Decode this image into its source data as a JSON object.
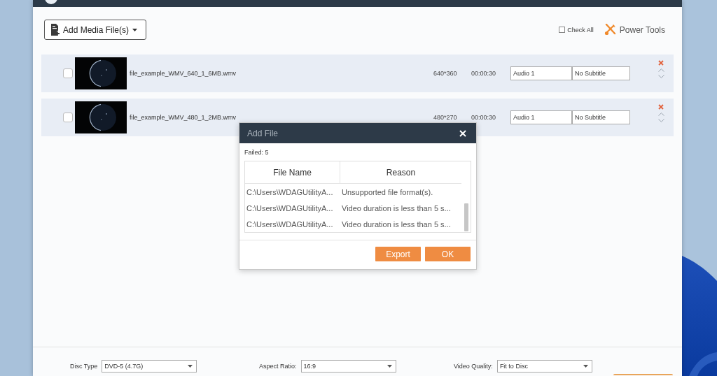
{
  "toolbar": {
    "add_media": "Add Media File(s)",
    "check_all": {
      "label": "Check All",
      "checked": false
    },
    "power_tools": "Power Tools"
  },
  "files": [
    {
      "checked": false,
      "name": "file_example_WMV_640_1_6MB.wmv",
      "resolution": "640*360",
      "duration": "00:00:30",
      "audio": "Audio 1",
      "subtitle": "No Subtitle"
    },
    {
      "checked": false,
      "name": "file_example_WMV_480_1_2MB.wmv",
      "resolution": "480*270",
      "duration": "00:00:30",
      "audio": "Audio 1",
      "subtitle": "No Subtitle"
    }
  ],
  "dialog": {
    "title": "Add File",
    "summary": "Failed: 5",
    "columns": [
      "File Name",
      "Reason"
    ],
    "rows": [
      [
        "C:\\Users\\WDAGUtilityA...",
        "Unsupported file format(s)."
      ],
      [
        "C:\\Users\\WDAGUtilityA...",
        "Video duration is less than 5 s..."
      ],
      [
        "C:\\Users\\WDAGUtilityA...",
        "Video duration is less than 5 s..."
      ]
    ],
    "buttons": [
      "Export",
      "OK"
    ]
  },
  "settings": [
    {
      "label": "Disc Type",
      "value": "DVD-5 (4.7G)"
    },
    {
      "label": "Aspect Ratio:",
      "value": "16:9"
    },
    {
      "label": "Video Quality:",
      "value": "Fit to Disc"
    }
  ]
}
